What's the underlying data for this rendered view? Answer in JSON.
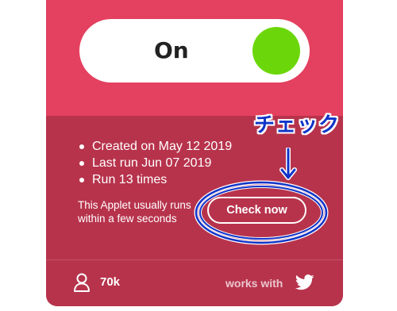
{
  "applet": {
    "toggle": {
      "label": "On",
      "knob_color": "#6bd70a"
    },
    "stats": [
      "Created on May 12 2019",
      "Last run Jun 07 2019",
      "Run 13 times"
    ],
    "usually_text": "This Applet usually runs within a few seconds",
    "check_button_label": "Check now",
    "footer": {
      "user_icon": "user-icon",
      "user_count": "70k",
      "works_with_label": "works with",
      "service_icon": "twitter-icon"
    },
    "colors": {
      "card_top": "#e4405f",
      "card_bottom": "#b7334c"
    }
  },
  "annotation": {
    "text": "チェック",
    "arrow_icon": "down-arrow-icon",
    "color": "#1034c8"
  }
}
